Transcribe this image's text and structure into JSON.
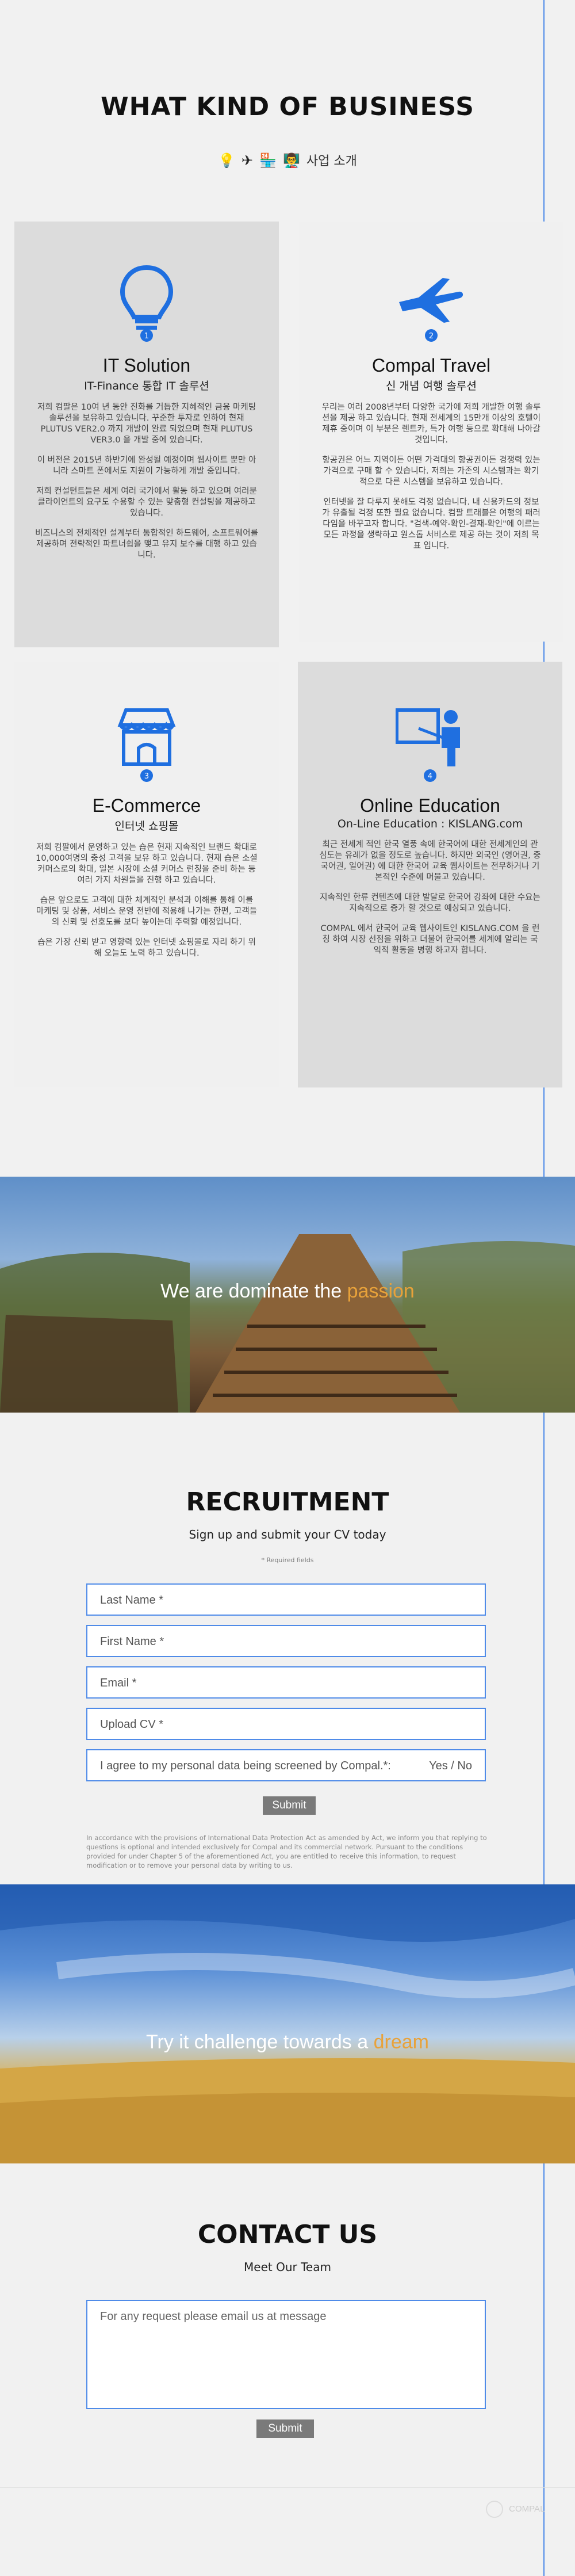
{
  "business": {
    "title": "WHAT KIND OF BUSINESS",
    "subtitle": "사업 소개",
    "subtitle_icons": [
      "bulb-icon",
      "plane-icon",
      "shop-icon",
      "teacher-icon"
    ]
  },
  "cards": [
    {
      "number": "1",
      "icon": "bulb-icon",
      "title": "IT Solution",
      "subtitle": "IT-Finance 통합 IT 솔루션",
      "paragraphs": [
        "저희 컴팔은 10여 년 동안 진화를 거듭한 지혜적인 금융 마케팅 솔루션을 보유하고 있습니다. 꾸준한 투자로 인하여 현재 PLUTUS VER2.0 까지 개발이 완료 되었으며 현재 PLUTUS VER3.0 을 개발 중에 있습니다.",
        "이 버전은 2015년 하반기에 완성될 예정이며 웹사이트 뿐만 아니라 스마트 폰에서도 지원이 가능하게 개발 중입니다.",
        "저희 컨설턴트들은 세계 여러 국가에서 활동 하고 있으며 여러분 클라이언트의 요구도 수용할 수 있는 맞춤형 컨설팅을 제공하고 있습니다.",
        "비즈니스의 전체적인 설계부터 통합적인 하드웨어, 소프트웨어를 제공하며 전략적인 파트너쉽을 맺고 유지 보수를 대행 하고 있습니다."
      ]
    },
    {
      "number": "2",
      "icon": "plane-icon",
      "title": "Compal Travel",
      "subtitle": "신 개념 여행 솔루션",
      "paragraphs": [
        "우리는 여러 2008년부터 다양한 국가에 저희 개발한 여행 솔루션을 제공 하고 있습니다. 현재 전세계의 15만개 이상의 호텔이 제휴 중이며 이 부분은 렌트카, 특가 여행 등으로 확대해 나아갈 것입니다.",
        "항공권은 어느 지역이든 어떤 가격대의 항공권이든 경쟁력 있는 가격으로 구매 할 수 있습니다. 저희는 가존의 시스템과는 확기적으로 다른 시스템을 보유하고 있습니다.",
        "인터넷을 잘 다루지 못해도 걱정 없습니다. 내 신용카드의 정보가 유출될 걱정 또한 필요 없습니다. 컴팔 트래블은 여행의 패러다임을 바꾸고자 합니다. \"검색-예약-확인-결재-확인\"에 이르는 모든 과정을 생략하고 원스톱 서비스로 제공 하는 것이 저희 목표 입니다."
      ]
    },
    {
      "number": "3",
      "icon": "shop-icon",
      "title": "E-Commerce",
      "subtitle": "인터넷 쇼핑몰",
      "paragraphs": [
        "저희 컴팔에서 운영하고 있는 숍은 현재 지속적인 브랜드 확대로 10,000여명의 충성 고객을 보유 하고 있습니다. 현재 숍은 소셜 커머스로의 확대, 일본 시장에 소셜 커머스 런칭을 준비 하는 등 여러 가지 차원들을 진행 하고 있습니다.",
        "숍은 앞으로도 고객에 대한 체계적인 분석과 이해를 통해 이를 마케팅 및 상품, 서비스 운영 전반에 적용해 나가는 한편, 고객들의 신뢰 및 선호도를 보다 높이는데 주력할 예정입니다.",
        "숍은 가장 신뢰 받고 영향력 있는 인터넷 쇼핑몰로 자리 하기 위해 오늘도 노력 하고 있습니다."
      ]
    },
    {
      "number": "4",
      "icon": "teacher-icon",
      "title": "Online Education",
      "subtitle": "On-Line Education : KISLANG.com",
      "paragraphs": [
        "최근 전세계 적인 한국 열풍 속에 한국어에 대한 전세계인의 관심도는 유례가 없을 정도로 높습니다. 하지만 외국인 (영어권, 중국어권, 일어권) 에 대한 한국어 교육 웹사이트는 전무하거나 기본적인 수준에 머물고 있습니다.",
        "지속적인 한류 컨텐츠에 대한 발달로 한국어 강좌에 대한 수요는 지속적으로 증가 할 것으로 예상되고 있습니다.",
        "COMPAL 에서 한국어 교육 웹사이트인 KISLANG.COM 을 런칭 하여 시장 선점을 위하고 더불어 한국어를 세계에 알리는 국익적 활동을 병행 하고자 합니다."
      ]
    }
  ],
  "banner1": {
    "text_before": "We are dominate the",
    "text_accent": "passion"
  },
  "recruitment": {
    "title": "RECRUITMENT",
    "subtitle": "Sign up and submit your CV today",
    "required_note": "* Required fields",
    "fields": {
      "last_name": "Last Name *",
      "first_name": "First Name *",
      "email": "Email *",
      "upload_cv": "Upload CV *",
      "consent": "I agree to my personal data being screened by Compal.*:",
      "consent_options": "Yes / No"
    },
    "submit_label": "Submit",
    "legal": "In accordance with the provisions of International Data Protection Act as amended by Act, we inform you that replying to questions is optional and intended exclusively for Compal and its commercial network. Pursuant to the conditions provided for under Chapter 5 of the aforementioned Act, you are entitled to receive this information, to request modification or to remove your personal data by writing to us."
  },
  "banner2": {
    "text_before": "Try it challenge towards a",
    "text_accent": "dream"
  },
  "contact": {
    "title": "CONTACT US",
    "subtitle": "Meet Our Team",
    "message_placeholder": "For any request please email us at message",
    "submit_label": "Submit"
  },
  "footer": {
    "logo_text": "COMPAL"
  },
  "colors": {
    "accent_blue": "#4f8be8",
    "icon_blue": "#1f6fe0",
    "accent_orange": "#e8a23a",
    "button_gray": "#7a7a7a"
  }
}
